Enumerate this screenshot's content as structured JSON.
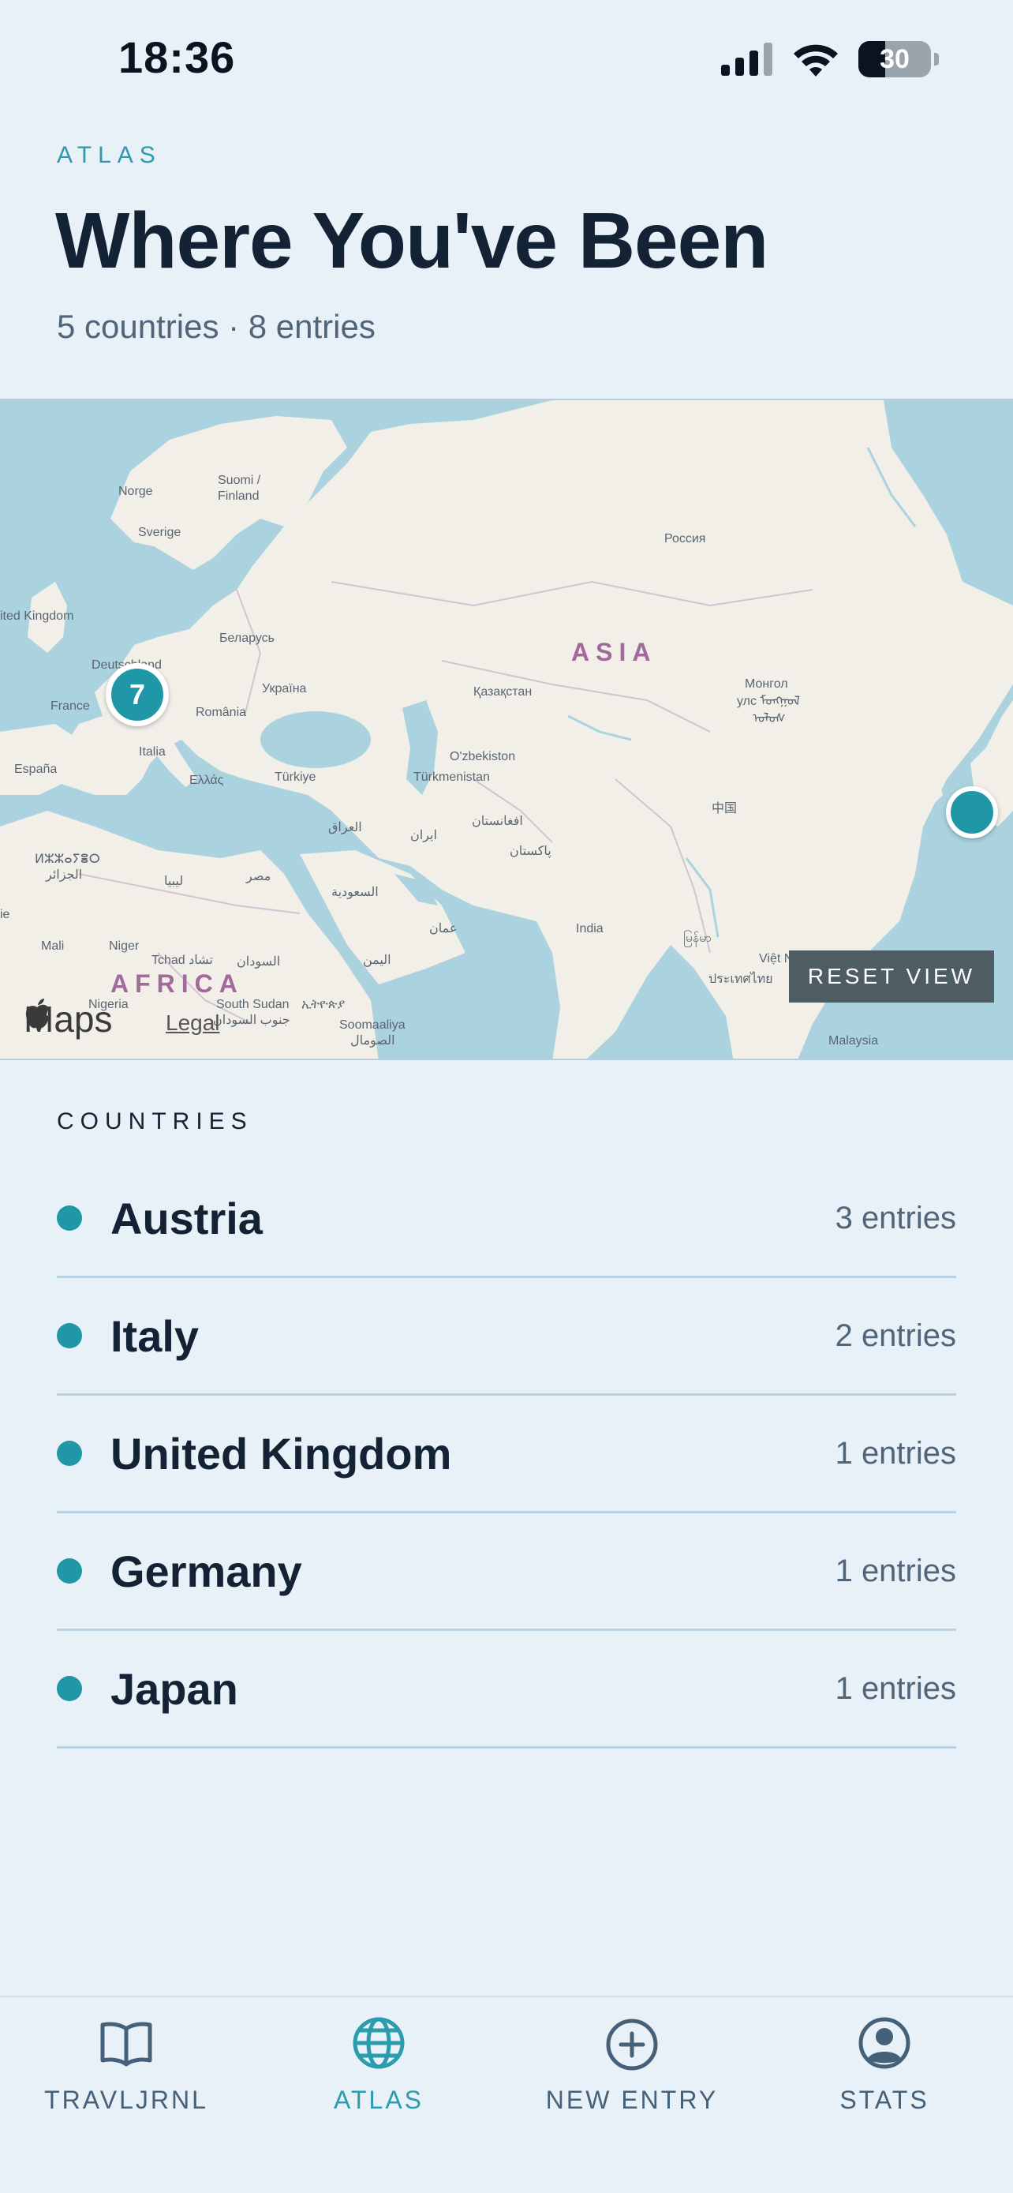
{
  "status_bar": {
    "time": "18:36",
    "battery": "30",
    "icons": [
      "cellular-signal-icon",
      "wifi-icon",
      "battery-icon"
    ]
  },
  "header": {
    "app_label": "ATLAS",
    "title": "Where You've Been",
    "subtitle": "5 countries · 8 entries"
  },
  "map": {
    "labels": {
      "norge": "Norge",
      "suomi": "Suomi /",
      "finland": "Finland",
      "sverige": "Sverige",
      "rossiya": "Россия",
      "united_kingdom": "ited Kingdom",
      "belarus": "Беларусь",
      "deutschland": "Deutschland",
      "asia": "ASIA",
      "mongol": "Монгол",
      "mongol_2": "улс ᠮᠣᠩᠭᠣᠯ",
      "mongol_3": "ᠤᠯᠤᠰ",
      "ukraina": "Україна",
      "kazakhstan": "Қазақстан",
      "france": "France",
      "romania": "România",
      "italia": "Italia",
      "espana": "España",
      "ellas": "Ελλάς",
      "turkiye": "Türkiye",
      "uzbekistan": "O'zbekiston",
      "turkmenistan": "Türkmenistan",
      "zhongguo": "中国",
      "afghanistan": "افغانستان",
      "iraq": "العراق",
      "iran": "ایران",
      "pakistan": "پاکستان",
      "algeria_1": "ⵍⵣⵣⴰⵢⴻⵔ",
      "algeria_2": "الجزائر",
      "libya": "ليبيا",
      "misr": "مصر",
      "saudi": "السعودية",
      "oman": "عمان",
      "india": "India",
      "mali": "Mali",
      "niger": "Niger",
      "tchad": "Tchad تشاد",
      "sudan": "السودان",
      "yemen": "اليمن",
      "africa": "AFRICA",
      "nigeria": "Nigeria",
      "south_sudan": "South Sudan",
      "south_sudan_ar": "جنوب السودان",
      "ethiopia": "ኢትዮጵያ",
      "somalia": "Soomaaliya",
      "somalia_ar": "الصومال",
      "myanmar": "မြန်မာ",
      "thailand": "ประเทศไทย",
      "vietnam": "Việt Nam",
      "malaysia": "Malaysia",
      "edge_ie": "ie"
    },
    "cluster_count": "7",
    "reset_label": "RESET VIEW",
    "brand": "Maps",
    "legal": "Legal"
  },
  "countries": {
    "section_label": "COUNTRIES",
    "items": [
      {
        "name": "Austria",
        "count": "3 entries"
      },
      {
        "name": "Italy",
        "count": "2 entries"
      },
      {
        "name": "United Kingdom",
        "count": "1 entries"
      },
      {
        "name": "Germany",
        "count": "1 entries"
      },
      {
        "name": "Japan",
        "count": "1 entries"
      }
    ]
  },
  "tab_bar": {
    "tabs": [
      {
        "label": "TRAVLJRNL",
        "icon": "book-icon"
      },
      {
        "label": "ATLAS",
        "icon": "globe-icon",
        "active": true
      },
      {
        "label": "NEW ENTRY",
        "icon": "plus-circle-icon"
      },
      {
        "label": "STATS",
        "icon": "user-circle-icon"
      }
    ]
  },
  "colors": {
    "accent": "#1f97a7",
    "background": "#e8f1f7",
    "title": "#142235",
    "water": "#aad3df",
    "land": "#f2efe9"
  }
}
